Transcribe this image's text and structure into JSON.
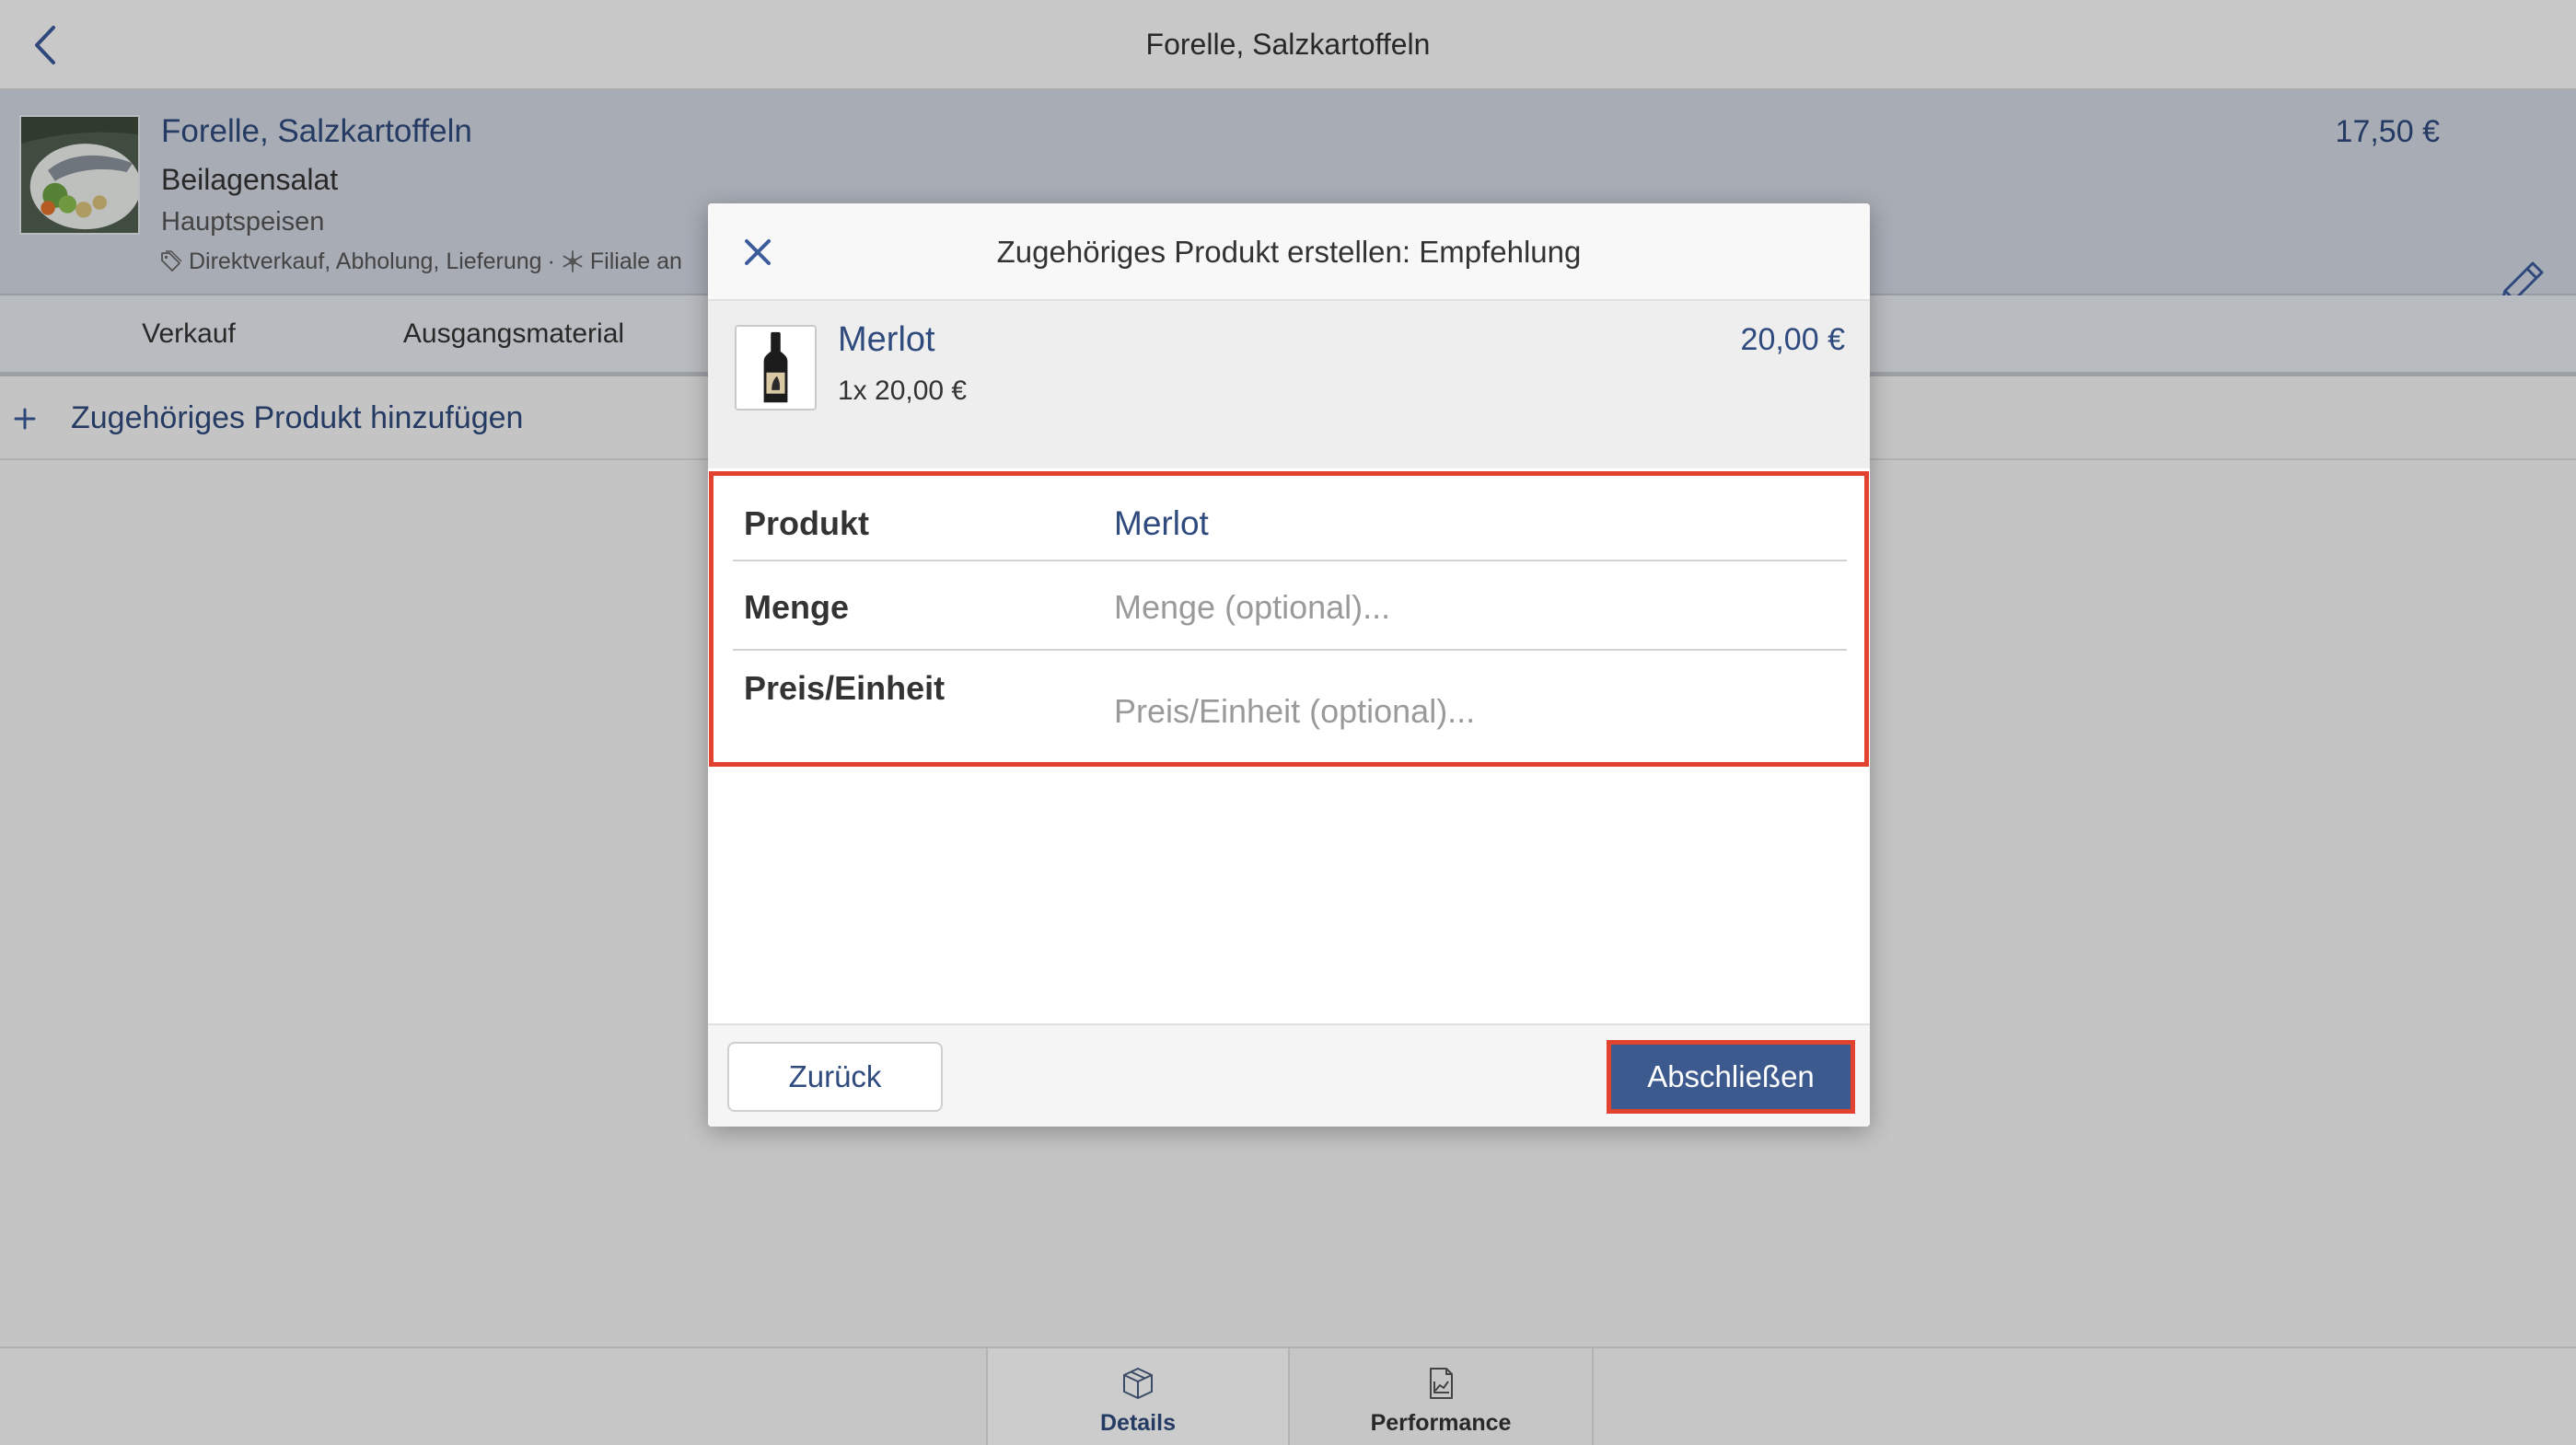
{
  "top_bar": {
    "title": "Forelle, Salzkartoffeln",
    "back_icon": "chevron-left-icon"
  },
  "product": {
    "name": "Forelle, Salzkartoffeln",
    "side_dish": "Beilagensalat",
    "category": "Hauptspeisen",
    "channels_icon": "tag-icon",
    "channels": "Direktverkauf, Abholung, Lieferung",
    "separator": "·",
    "location_icon": "snowflake-icon",
    "location": "Filiale an",
    "price": "17,50 €",
    "edit_icon": "pencil-icon"
  },
  "tabs": [
    {
      "label": "Verkauf"
    },
    {
      "label": "Ausgangsmaterial"
    }
  ],
  "add_related": {
    "icon": "plus-icon",
    "label": "Zugehöriges Produkt hinzufügen"
  },
  "dialog": {
    "close_icon": "close-icon",
    "title": "Zugehöriges Produkt erstellen: Empfehlung",
    "preview": {
      "name": "Merlot",
      "quantity_line": "1x 20,00 €",
      "total": "20,00 €"
    },
    "fields": {
      "product": {
        "label": "Produkt",
        "value": "Merlot"
      },
      "quantity": {
        "label": "Menge",
        "placeholder": "Menge (optional)..."
      },
      "unit_price": {
        "label": "Preis/Einheit",
        "placeholder": "Preis/Einheit (optional)..."
      }
    },
    "footer": {
      "back_label": "Zurück",
      "finish_label": "Abschließen"
    }
  },
  "bottom_tabs": [
    {
      "label": "Details",
      "icon": "box-icon",
      "selected": true
    },
    {
      "label": "Performance",
      "icon": "chart-document-icon",
      "selected": false
    }
  ],
  "colors": {
    "accent": "#2f4a7d",
    "primary_button": "#3d5a8e",
    "highlight_outline": "#e2432f"
  }
}
